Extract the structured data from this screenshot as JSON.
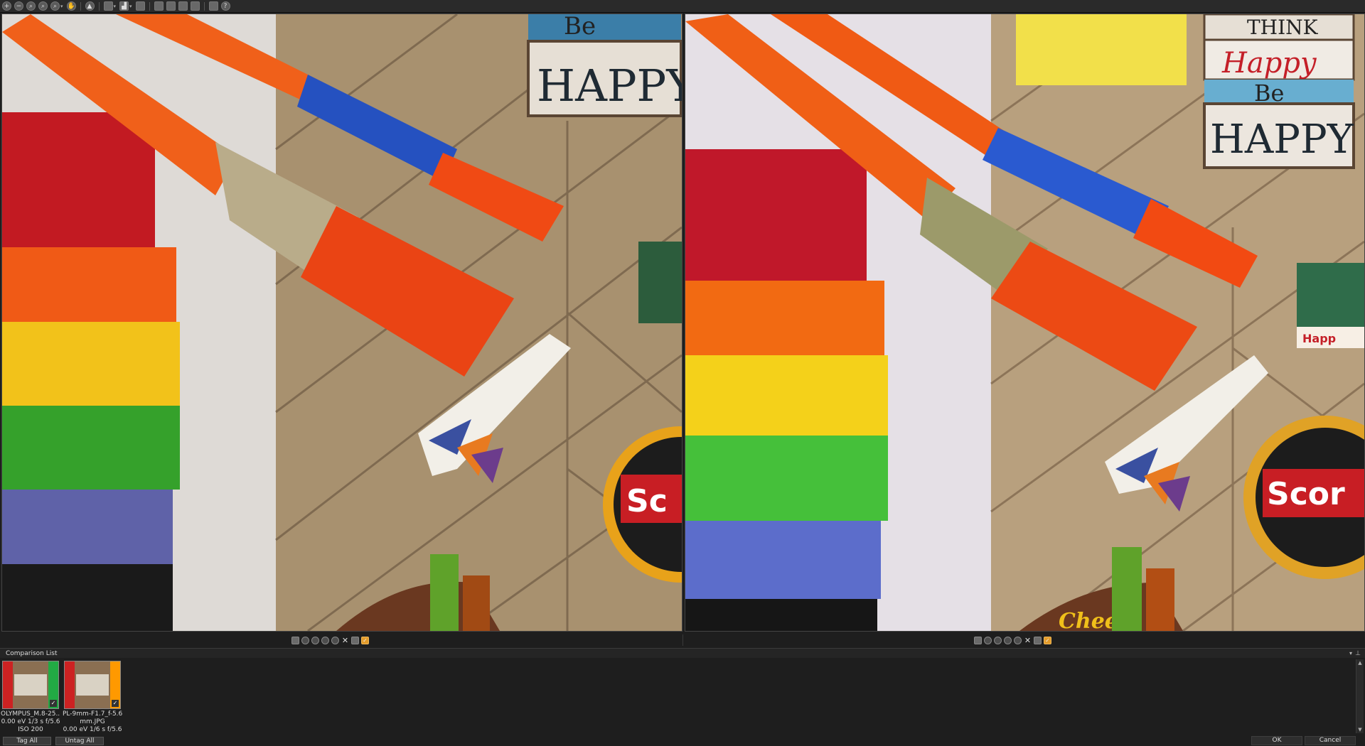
{
  "toolbar": {
    "icons": [
      "zoom-in-icon",
      "zoom-out-icon",
      "zoom-fit-icon",
      "zoom-actual-icon",
      "magnify-icon",
      "pan-hand-icon",
      "single-view-icon",
      "highlight-icon",
      "histogram-icon",
      "layout-icon",
      "compare-icon",
      "crop-icon",
      "copy-icon",
      "settings-icon",
      "help-icon"
    ],
    "help_glyph": "?"
  },
  "viewers": {
    "left": {
      "sign_line1": "Be",
      "sign_line2": "HAPPY",
      "dartboard_text": "Sc"
    },
    "right": {
      "sign_line0": "THINK",
      "sign_line1": "Happy",
      "sign_line2": "Be",
      "sign_line3": "HAPPY",
      "dartboard_text": "Scor",
      "badge_text": "Happ",
      "cheers_text": "Cheers"
    }
  },
  "comparison_list": {
    "title": "Comparison List",
    "items": [
      {
        "name": "OLYMPUS_M.8-25...",
        "line2": "0.00 eV  1/3 s  f/5.6",
        "line3": "ISO 200",
        "checked": "✓"
      },
      {
        "name": "PL-9mm-F1.7_f-5.6...",
        "line2": "mm.JPG",
        "line3": "0.00 eV  1/6 s  f/5.6",
        "checked": "✓"
      }
    ],
    "tag_all": "Tag All",
    "untag_all": "Untag All"
  },
  "footer": {
    "ok": "OK",
    "cancel": "Cancel"
  },
  "colors": {
    "accent": "#e39b2a",
    "background": "#1e1e1e"
  }
}
